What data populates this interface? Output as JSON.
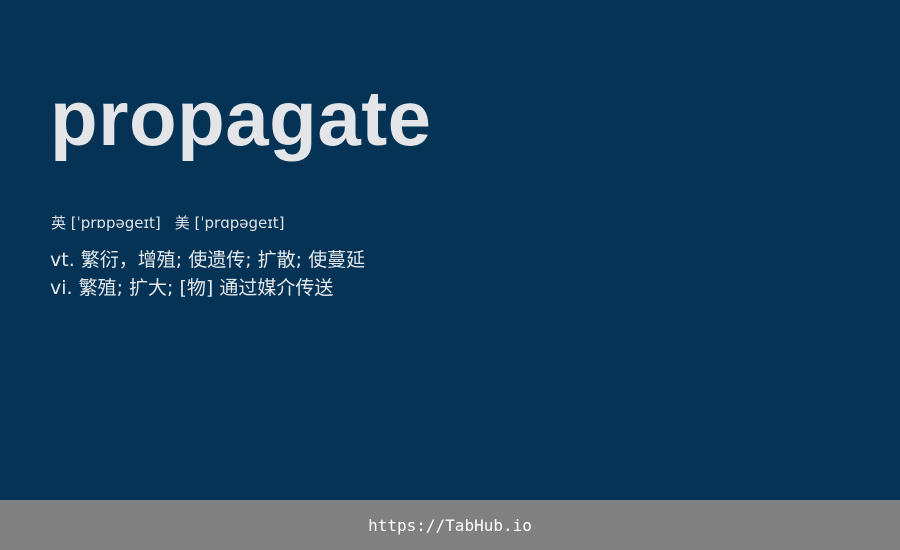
{
  "card": {
    "word": "propagate",
    "phonetics": {
      "uk": "英 [ˈprɒpəgeɪt]",
      "us": "美 [ˈprɑpəgeɪt]"
    },
    "definitions": [
      "vt. 繁衍，增殖; 使遗传; 扩散; 使蔓延",
      "vi. 繁殖; 扩大; [物] 通过媒介传送"
    ]
  },
  "footer": {
    "link": "https://TabHub.io"
  },
  "colors": {
    "background": "#043356",
    "word": "#e3e5e8",
    "footer_bg": "#808080",
    "footer_text": "#ffffff"
  }
}
